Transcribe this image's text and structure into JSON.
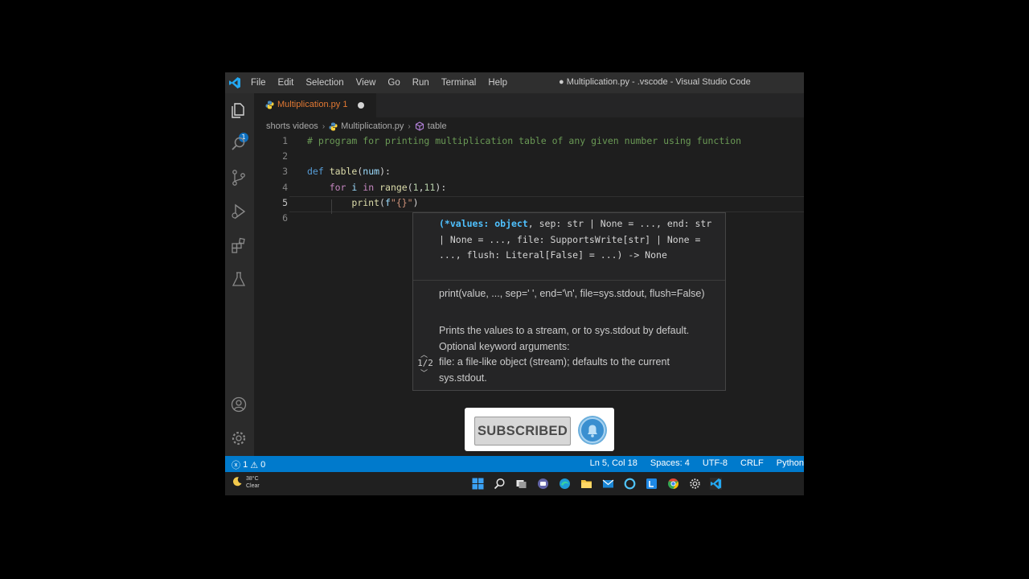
{
  "titlebar": {
    "menu": [
      "File",
      "Edit",
      "Selection",
      "View",
      "Go",
      "Run",
      "Terminal",
      "Help"
    ],
    "window_title": "● Multiplication.py - .vscode - Visual Studio Code"
  },
  "activity_bar": {
    "explorer_badge": "1",
    "icons": [
      "files-icon",
      "search-icon",
      "source-control-icon",
      "run-debug-icon",
      "extensions-icon",
      "testing-icon",
      "account-icon",
      "settings-gear-icon"
    ]
  },
  "tab": {
    "label": "Multiplication.py 1"
  },
  "breadcrumb": {
    "folder": "shorts videos",
    "file": "Multiplication.py",
    "symbol": "table"
  },
  "editor": {
    "line_numbers": [
      "1",
      "2",
      "3",
      "4",
      "5",
      "6"
    ],
    "lines": [
      "# program for printing multiplication table of any given number using function",
      "",
      "def table(num):",
      "    for i in range(1,11):",
      "        print(f\"{}\")",
      ""
    ]
  },
  "hover": {
    "signature_param": "(*values: object",
    "signature_rest": ", sep: str | None = ..., end: str | None = ..., file: SupportsWrite[str] | None = ..., flush: Literal[False] = ...) -> None",
    "doc_signature": "print(value, ..., sep=' ', end='\\n', file=sys.stdout, flush=False)",
    "doc_text": "Prints the values to a stream, or to sys.stdout by default. Optional keyword arguments:",
    "doc_text2": "file: a file-like object (stream); defaults to the current sys.stdout.",
    "pager": "1/2"
  },
  "overlay": {
    "subscribed_label": "SUBSCRIBED"
  },
  "status": {
    "errors": "1",
    "warnings": "0",
    "position": "Ln 5, Col 18",
    "spaces": "Spaces: 4",
    "encoding": "UTF-8",
    "eol": "CRLF",
    "language": "Python"
  },
  "taskbar": {
    "temperature": "38°C",
    "condition": "Clear",
    "icons": [
      "windows-start-icon",
      "search-icon",
      "task-view-icon",
      "chat-icon",
      "edge-icon",
      "file-explorer-icon",
      "mail-icon",
      "cortana-icon",
      "store-icon",
      "chrome-icon",
      "settings-icon",
      "vscode-icon"
    ]
  },
  "colors": {
    "accent": "#007acc",
    "modified_tab": "#e37933",
    "background": "#1e1e1e"
  }
}
